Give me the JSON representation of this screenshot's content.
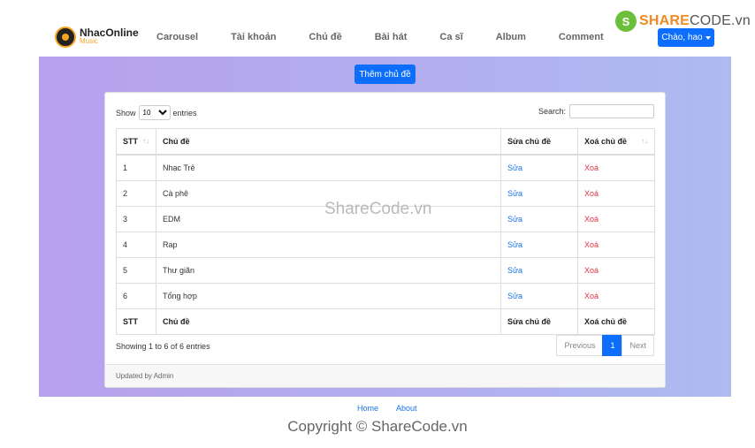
{
  "brand": {
    "logo_main": "NhacOnline",
    "logo_sub": "Music"
  },
  "nav": {
    "items": [
      "Carousel",
      "Tài khoản",
      "Chủ đề",
      "Bài hát",
      "Ca sĩ",
      "Album",
      "Comment"
    ],
    "user_label": "Chào, hao"
  },
  "watermark_logo": {
    "icon": "S",
    "name_accent": "SHARE",
    "name_rest": "CODE.vn"
  },
  "page": {
    "add_button": "Thêm chủ đề",
    "show_label": "Show",
    "entries_label": "entries",
    "page_size": "10",
    "search_label": "Search:",
    "search_value": "",
    "info": "Showing 1 to 6 of 6 entries",
    "footer": "Updated by Admin"
  },
  "table": {
    "headers": [
      "STT",
      "Chủ đề",
      "Sửa chủ đề",
      "Xoá chủ đề"
    ],
    "rows": [
      {
        "stt": "1",
        "name": "Nhạc Trẻ",
        "edit": "Sửa",
        "delete": "Xoá"
      },
      {
        "stt": "2",
        "name": "Cà phê",
        "edit": "Sửa",
        "delete": "Xoá"
      },
      {
        "stt": "3",
        "name": "EDM",
        "edit": "Sửa",
        "delete": "Xoá"
      },
      {
        "stt": "4",
        "name": "Rap",
        "edit": "Sửa",
        "delete": "Xoá"
      },
      {
        "stt": "5",
        "name": "Thư giãn",
        "edit": "Sửa",
        "delete": "Xoá"
      },
      {
        "stt": "6",
        "name": "Tổng hợp",
        "edit": "Sửa",
        "delete": "Xoá"
      }
    ]
  },
  "pagination": {
    "previous": "Previous",
    "current": "1",
    "next": "Next"
  },
  "footer": {
    "links": [
      "Home",
      "About"
    ],
    "copyright": "Copyright © ShareCode.vn"
  },
  "overlay_watermark": "ShareCode.vn"
}
